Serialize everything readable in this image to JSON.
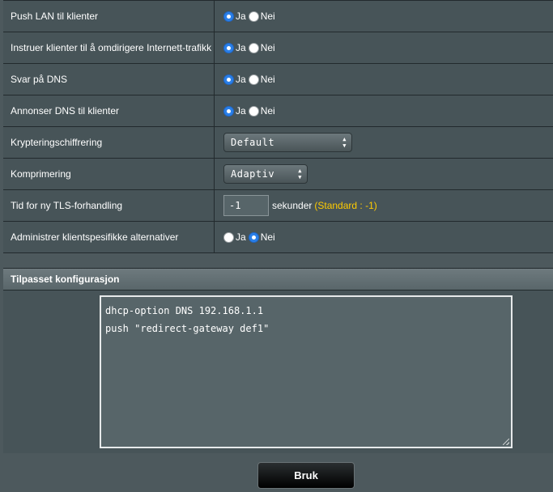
{
  "settings": [
    {
      "label": "Push LAN til klienter",
      "type": "radio",
      "options": [
        "Ja",
        "Nei"
      ],
      "selected": "Ja"
    },
    {
      "label": "Instruer klienter til å omdirigere Internett-trafikk",
      "type": "radio",
      "options": [
        "Ja",
        "Nei"
      ],
      "selected": "Ja"
    },
    {
      "label": "Svar på DNS",
      "type": "radio",
      "options": [
        "Ja",
        "Nei"
      ],
      "selected": "Ja"
    },
    {
      "label": "Annonser DNS til klienter",
      "type": "radio",
      "options": [
        "Ja",
        "Nei"
      ],
      "selected": "Ja"
    },
    {
      "label": "Krypteringschiffrering",
      "type": "select",
      "value": "Default"
    },
    {
      "label": "Komprimering",
      "type": "select",
      "value": "Adaptiv"
    },
    {
      "label": "Tid for ny TLS-forhandling",
      "type": "input",
      "value": "-1",
      "suffix": "sekunder",
      "hint": "(Standard : -1)"
    },
    {
      "label": "Administrer klientspesifikke alternativer",
      "type": "radio",
      "options": [
        "Ja",
        "Nei"
      ],
      "selected": "Nei"
    }
  ],
  "custom_config": {
    "title": "Tilpasset konfigurasjon",
    "content": "dhcp-option DNS 192.168.1.1\npush \"redirect-gateway def1\""
  },
  "apply_button": {
    "label": "Bruk"
  },
  "colors": {
    "background": "#4d595d",
    "row_background": "#475458",
    "radio_checked": "#2a7fe8",
    "hint": "#ffcc00"
  }
}
